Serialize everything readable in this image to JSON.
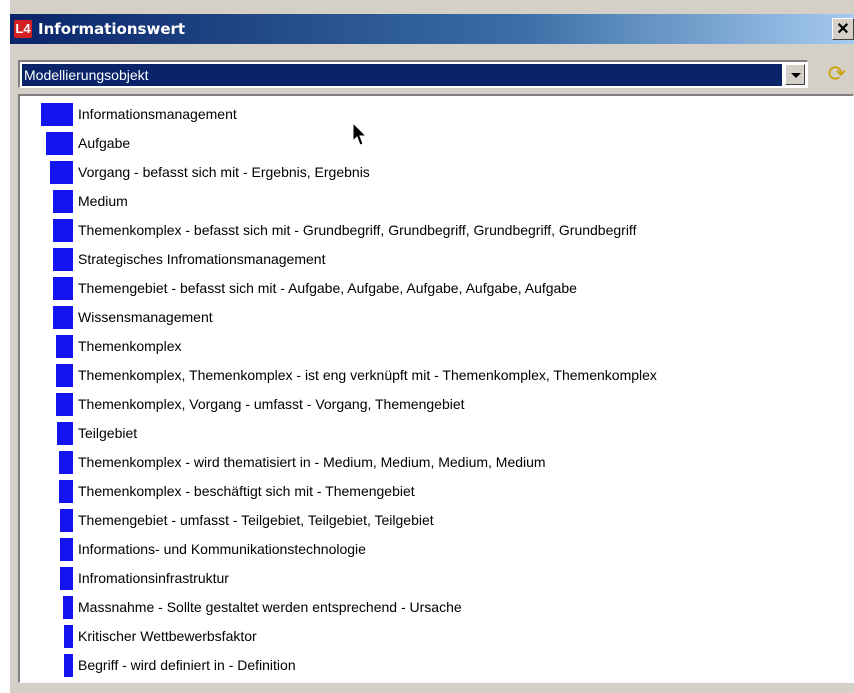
{
  "window": {
    "app_icon_glyph": "L4",
    "title": "Informationswert",
    "close_glyph": "✕"
  },
  "selector": {
    "value": "Modellierungsobjekt",
    "refresh_icon": "refresh-icon"
  },
  "list": {
    "items": [
      {
        "label": "Informationsmanagement",
        "weight": 1.0
      },
      {
        "label": "Aufgabe",
        "weight": 0.8
      },
      {
        "label": "Vorgang - befasst sich mit - Ergebnis, Ergebnis",
        "weight": 0.65
      },
      {
        "label": "Medium",
        "weight": 0.55
      },
      {
        "label": "Themenkomplex - befasst sich mit - Grundbegriff, Grundbegriff, Grundbegriff, Grundbegriff",
        "weight": 0.55
      },
      {
        "label": "Strategisches Infromationsmanagement",
        "weight": 0.55
      },
      {
        "label": "Themengebiet - befasst sich mit - Aufgabe, Aufgabe, Aufgabe, Aufgabe, Aufgabe",
        "weight": 0.55
      },
      {
        "label": "Wissensmanagement",
        "weight": 0.55
      },
      {
        "label": "Themenkomplex",
        "weight": 0.45
      },
      {
        "label": "Themenkomplex, Themenkomplex - ist eng verknüpft mit - Themenkomplex, Themenkomplex",
        "weight": 0.45
      },
      {
        "label": "Themenkomplex, Vorgang - umfasst - Vorgang, Themengebiet",
        "weight": 0.45
      },
      {
        "label": "Teilgebiet",
        "weight": 0.4
      },
      {
        "label": "Themenkomplex - wird thematisiert in - Medium, Medium, Medium, Medium",
        "weight": 0.35
      },
      {
        "label": "Themenkomplex - beschäftigt sich mit - Themengebiet",
        "weight": 0.35
      },
      {
        "label": "Themengebiet - umfasst - Teilgebiet, Teilgebiet, Teilgebiet",
        "weight": 0.3
      },
      {
        "label": "Informations- und Kommunikationstechnologie",
        "weight": 0.3
      },
      {
        "label": "Infromationsinfrastruktur",
        "weight": 0.3
      },
      {
        "label": "Massnahme - Sollte gestaltet werden entsprechend - Ursache",
        "weight": 0.2
      },
      {
        "label": "Kritischer Wettbewerbsfaktor",
        "weight": 0.15
      },
      {
        "label": "Begriff - wird definiert in - Definition",
        "weight": 0.15
      }
    ]
  },
  "colors": {
    "bar": "#1414f0",
    "selection": "#0a246a"
  }
}
